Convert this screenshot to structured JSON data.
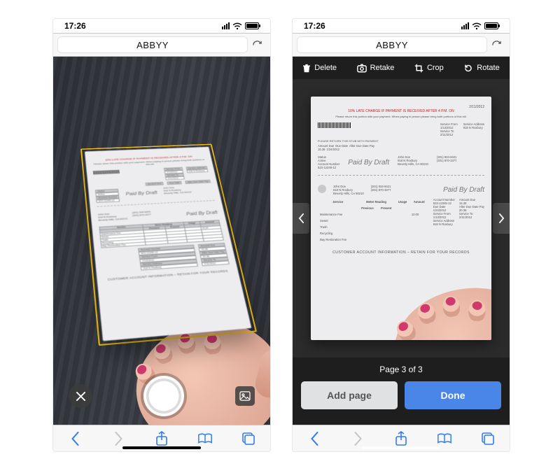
{
  "status": {
    "time": "17:26"
  },
  "safari": {
    "title": "ABBYY"
  },
  "bill": {
    "redline": "10% LATE CHARGE IF PAYMENT IS RECEIVED AFTER 4 P.M. ON",
    "bill_date": "2/11/2012",
    "return_note_small": "Please return this portion with your payment. When paying in person please bring both portions of this bill.",
    "return_note_caps": "PLEASE RETURN THIS STUB WITH PAYMENT",
    "labels": {
      "service_from": "Service From",
      "service_to": "Service To",
      "service_address": "Service Address",
      "amount_due": "Amount Due",
      "due_date": "Due Date",
      "after_due_pay": "After Due Date Pay",
      "status": "Status",
      "account_number": "Account Number",
      "amount_due2": "Amount Due"
    },
    "values": {
      "service_from": "1/13/2012",
      "service_to": "2/11/2012",
      "service_address": "918 N Roxbury",
      "amount_due": "15.36",
      "due_date": "1/24/2012",
      "after_due_pay": "",
      "status": "Active",
      "account_number": "523-12345-12",
      "account_number2": "523-12345-12",
      "amount_due2": "15.36",
      "after_due_pay2": "20.36"
    },
    "customer": {
      "name": "John Doe",
      "addr1": "918 N Roxbury",
      "addr2": "Beverly Hills, CA 90210",
      "phone1": "(301) 934-8421",
      "phone2": "(301) 870-3377"
    },
    "paid_by_draft": "Paid By Draft",
    "table": {
      "headers": [
        "Service",
        "Meter Reading",
        "Usage",
        "Amount"
      ],
      "sub": [
        "",
        "Previous",
        "Present",
        "",
        ""
      ],
      "rows": [
        [
          "Maintenance Fee",
          "",
          "",
          "",
          "10.00"
        ],
        [
          "Sewer",
          "",
          "",
          "",
          ""
        ],
        [
          "Trash",
          "",
          "",
          "",
          ""
        ],
        [
          "Recycling",
          "",
          "",
          "",
          ""
        ],
        [
          "Bay Restoration Fee",
          "",
          "",
          "",
          ""
        ]
      ]
    },
    "footer": "CUSTOMER ACCOUNT INFORMATION – RETAIN FOR YOUR RECORDS"
  },
  "review": {
    "actions": {
      "delete": "Delete",
      "retake": "Retake",
      "crop": "Crop",
      "rotate": "Rotate"
    },
    "page_indicator": "Page 3 of 3",
    "add_page": "Add page",
    "done": "Done"
  }
}
